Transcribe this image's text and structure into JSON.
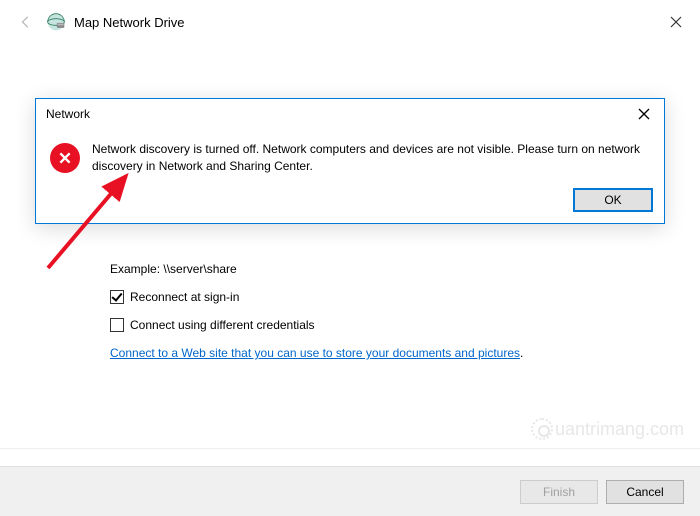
{
  "window": {
    "title": "Map Network Drive"
  },
  "content": {
    "example_label": "Example: \\\\server\\share",
    "reconnect_label": "Reconnect at sign-in",
    "reconnect_checked": true,
    "credentials_label": "Connect using different credentials",
    "credentials_checked": false,
    "link_text": "Connect to a Web site that you can use to store your documents and pictures"
  },
  "footer": {
    "finish_label": "Finish",
    "cancel_label": "Cancel"
  },
  "modal": {
    "title": "Network",
    "message": "Network discovery is turned off. Network computers and devices are not visible. Please turn on network discovery in Network and Sharing Center.",
    "ok_label": "OK"
  },
  "watermark": "uantrimang.com"
}
